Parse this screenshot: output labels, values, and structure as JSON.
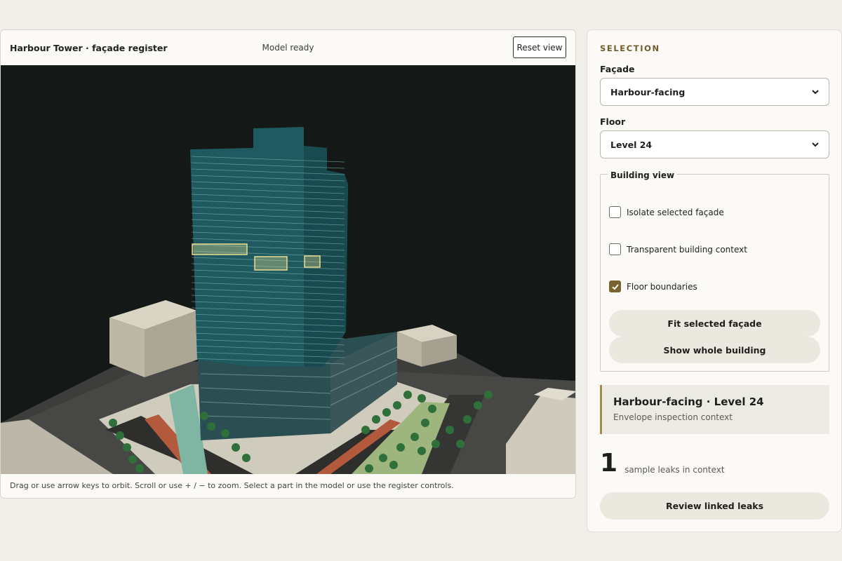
{
  "viewer": {
    "title": "Harbour Tower · façade register",
    "status": "Model ready",
    "reset_label": "Reset view",
    "help_text": "Drag or use arrow keys to orbit. Scroll or use + / − to zoom. Select a part in the model or use the register controls."
  },
  "panel": {
    "section_label": "SELECTION",
    "facade_label": "Façade",
    "facade_value": "Harbour-facing",
    "floor_label": "Floor",
    "floor_value": "Level 24",
    "building_view": {
      "legend": "Building view",
      "options": [
        {
          "label": "Isolate selected façade",
          "checked": false
        },
        {
          "label": "Transparent building context",
          "checked": false
        },
        {
          "label": "Floor boundaries",
          "checked": true
        }
      ],
      "fit_label": "Fit selected façade",
      "whole_label": "Show whole building"
    },
    "context": {
      "title": "Harbour-facing · Level 24",
      "subtitle": "Envelope inspection context"
    },
    "leaks_count": "1",
    "leaks_text": "sample leaks in context",
    "review_label": "Review linked leaks"
  },
  "colors": {
    "accent": "#7a642e",
    "tower": "#1f5a60",
    "highlight": "#e6dd8f",
    "viewport_bg": "#141816"
  }
}
